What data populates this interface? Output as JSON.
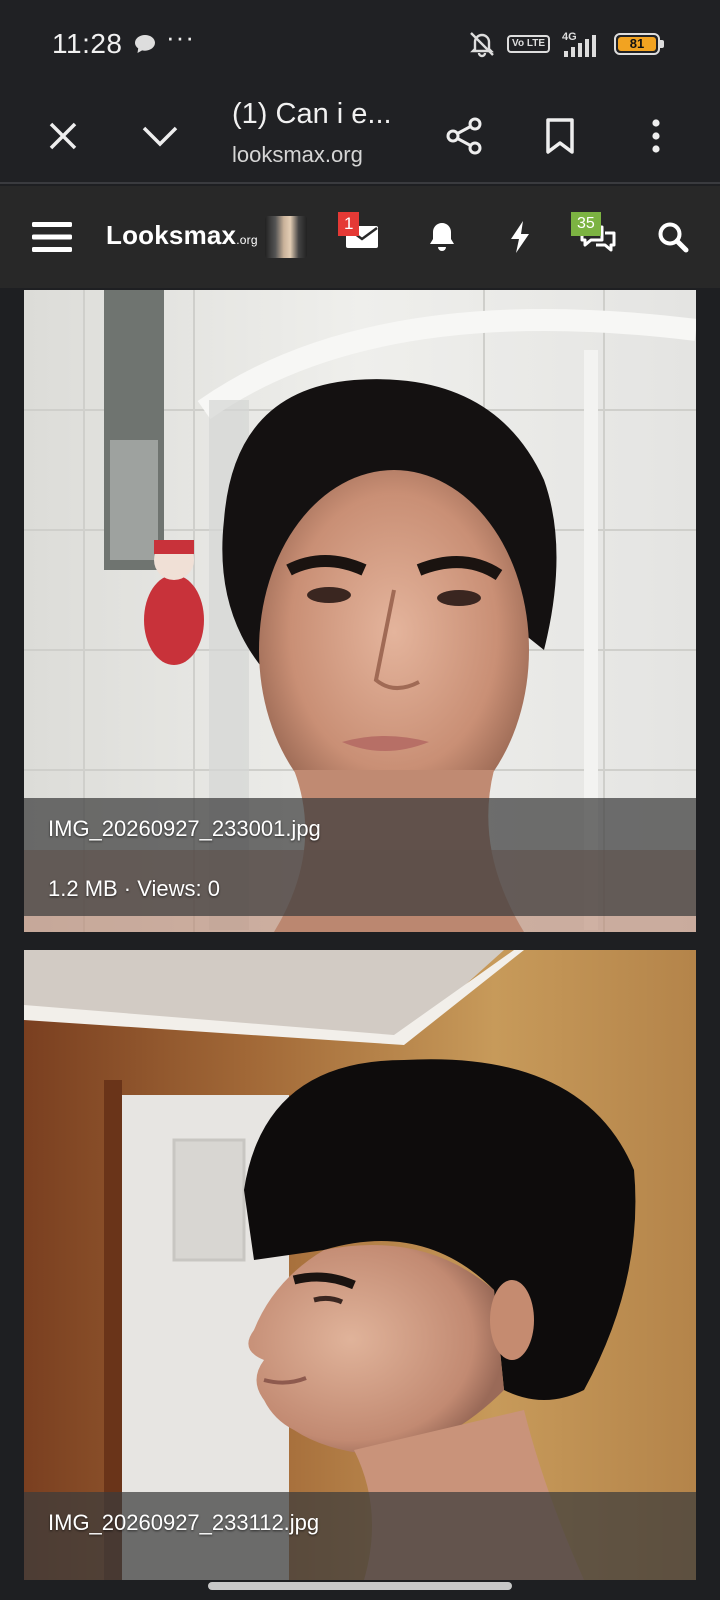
{
  "status_bar": {
    "time": "11:28",
    "dots": "···",
    "network": "4G",
    "volte": "Vo LTE",
    "battery": "81",
    "icons": [
      "chat-bubble-icon",
      "mute-vibrate-icon",
      "volte-icon",
      "signal-icon",
      "battery-icon"
    ]
  },
  "browser": {
    "tab_title": "(1) Can i e...",
    "url": "looksmax.org",
    "icons": [
      "close-icon",
      "chevron-down-icon",
      "share-icon",
      "bookmark-icon",
      "more-vert-icon"
    ]
  },
  "site_nav": {
    "logo_main": "Looksmax",
    "logo_suffix": ".org",
    "messages_badge": "1",
    "conversations_badge": "35",
    "icons": [
      "hamburger-icon",
      "avatar",
      "envelope-icon",
      "bell-icon",
      "bolt-icon",
      "chat-icon",
      "search-icon"
    ],
    "colors": {
      "badge_red": "#e53935",
      "badge_green": "#7cb342"
    }
  },
  "attachments": [
    {
      "filename": "IMG_20260927_233001.jpg",
      "meta": "1.2 MB · Views: 0"
    },
    {
      "filename": "IMG_20260927_233112.jpg"
    }
  ]
}
